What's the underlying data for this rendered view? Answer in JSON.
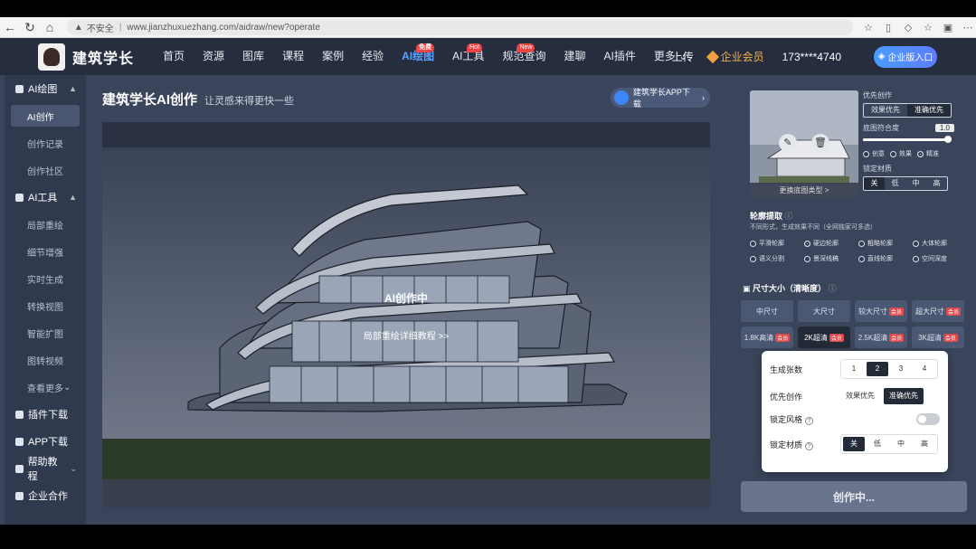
{
  "browser": {
    "security_label": "不安全",
    "url": "www.jianzhuxuezhang.com/aidraw/new?operate"
  },
  "header": {
    "brand": "建筑学长",
    "nav": [
      {
        "label": "首页",
        "badge": ""
      },
      {
        "label": "资源",
        "badge": ""
      },
      {
        "label": "图库",
        "badge": ""
      },
      {
        "label": "课程",
        "badge": ""
      },
      {
        "label": "案例",
        "badge": ""
      },
      {
        "label": "经验",
        "badge": ""
      },
      {
        "label": "AI绘图",
        "badge": "免费"
      },
      {
        "label": "AI工具",
        "badge": "Hot"
      },
      {
        "label": "规范查询",
        "badge": "New"
      },
      {
        "label": "建聊",
        "badge": ""
      },
      {
        "label": "AI插件",
        "badge": ""
      },
      {
        "label": "更多",
        "badge": ""
      }
    ],
    "upload": "上传",
    "vip": "企业会员",
    "phone": "173****4740",
    "enterprise_btn": "企业版入口"
  },
  "sidebar": {
    "groups": [
      {
        "label": "AI绘图",
        "items": [
          "AI创作",
          "创作记录",
          "创作社区"
        ]
      },
      {
        "label": "AI工具",
        "items": [
          "局部重绘",
          "细节增强",
          "实时生成",
          "转换视图",
          "智能扩图",
          "图转视频",
          "查看更多"
        ]
      },
      {
        "label": "插件下载",
        "items": []
      },
      {
        "label": "APP下载",
        "items": []
      },
      {
        "label": "帮助教程",
        "items": []
      },
      {
        "label": "企业合作",
        "items": []
      }
    ],
    "active_item": "AI创作"
  },
  "main": {
    "title": "建筑学长AI创作",
    "subtitle": "让灵感来得更快一些",
    "app_download": "建筑学长APP下载",
    "status": "AI创作中",
    "tutorial_link": "局部重绘详细教程 >>"
  },
  "right": {
    "preview_caption": "更换底图类型 >",
    "priority_label": "优先创作",
    "priority_options": [
      "效果优先",
      "准确优先"
    ],
    "similarity_label": "底图符合度",
    "similarity_value": "1.0",
    "similarity_fraction": 1.0,
    "mode_options": [
      "创意",
      "效果",
      "精准"
    ],
    "material_label": "锁定材质",
    "material_options": [
      "关",
      "低",
      "中",
      "高"
    ],
    "contour_title": "轮廓提取",
    "contour_sub": "不同形式，生成效果不同（全网独家可多选）",
    "contour_options": [
      "平滑轮廓",
      "硬边轮廓",
      "粗略轮廓",
      "大体轮廓",
      "语义分割",
      "景深线稿",
      "直线轮廓",
      "空间深度"
    ],
    "size_title": "尺寸大小（清晰度）",
    "size_options": [
      {
        "label": "中尺寸",
        "tag": ""
      },
      {
        "label": "大尺寸",
        "tag": ""
      },
      {
        "label": "较大尺寸",
        "tag": "会员"
      },
      {
        "label": "超大尺寸",
        "tag": "会员"
      },
      {
        "label": "1.8K高清",
        "tag": "会员"
      },
      {
        "label": "2K超清",
        "tag": "会员"
      },
      {
        "label": "2.5K超清",
        "tag": "会员"
      },
      {
        "label": "3K超清",
        "tag": "会员"
      }
    ],
    "create_btn": "创作中..."
  },
  "popup": {
    "count_label": "生成张数",
    "count_options": [
      "1",
      "2",
      "3",
      "4"
    ],
    "priority_label": "优先创作",
    "priority_options": [
      "效果优先",
      "准确优先"
    ],
    "style_lock_label": "锁定风格",
    "material_lock_label": "锁定材质",
    "material_options": [
      "关",
      "低",
      "中",
      "高"
    ]
  },
  "colors": {
    "header_bg": "#252d3f",
    "sidebar_bg": "#2f3a4f",
    "main_bg": "#3a455b",
    "accent": "#3f7fe8"
  }
}
